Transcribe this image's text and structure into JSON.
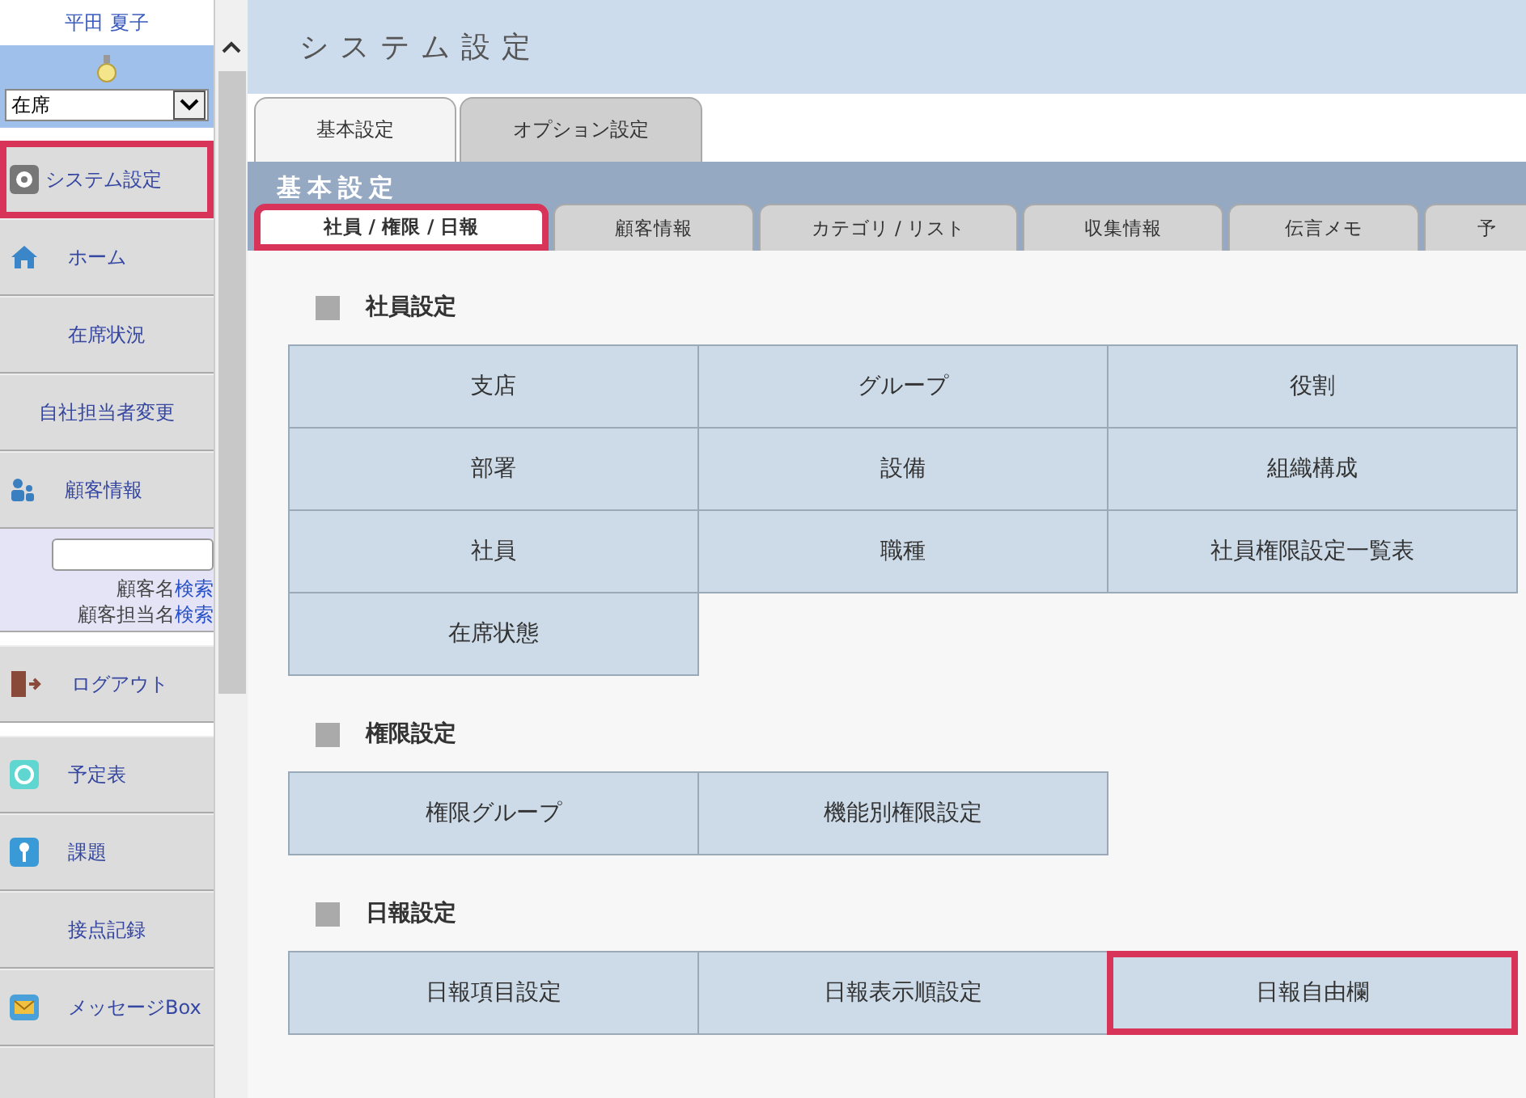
{
  "sidebar": {
    "user_name": "平田 夏子",
    "status_select": {
      "value": "在席"
    },
    "top_nav": [
      {
        "label": "システム設定",
        "highlighted": true
      },
      {
        "label": "ホーム",
        "highlighted": false
      },
      {
        "label": "在席状況",
        "highlighted": false
      },
      {
        "label": "自社担当者変更",
        "highlighted": false
      },
      {
        "label": "顧客情報",
        "highlighted": false
      }
    ],
    "customer_search": {
      "links": [
        {
          "label": "顧客名",
          "link": "検索"
        },
        {
          "label": "顧客担当名",
          "link": "検索"
        }
      ]
    },
    "logout": {
      "label": "ログアウト"
    },
    "bottom_nav": [
      {
        "label": "予定表"
      },
      {
        "label": "課題"
      },
      {
        "label": "接点記録"
      },
      {
        "label": "メッセージBox"
      }
    ]
  },
  "page": {
    "title": "システム設定",
    "tabs": [
      {
        "label": "基本設定",
        "selected": true
      },
      {
        "label": "オプション設定",
        "selected": false
      }
    ],
    "band_title": "基本設定",
    "subtabs": [
      {
        "label": "社員 / 権限 / 日報",
        "selected": true,
        "highlighted": true
      },
      {
        "label": "顧客情報",
        "selected": false,
        "highlighted": false
      },
      {
        "label": "カテゴリ / リスト",
        "selected": false,
        "highlighted": false
      },
      {
        "label": "収集情報",
        "selected": false,
        "highlighted": false
      },
      {
        "label": "伝言メモ",
        "selected": false,
        "highlighted": false
      },
      {
        "label": "予",
        "selected": false,
        "highlighted": false
      }
    ],
    "sections": [
      {
        "title": "社員設定",
        "buttons": [
          {
            "label": "支店",
            "highlighted": false
          },
          {
            "label": "グループ",
            "highlighted": false
          },
          {
            "label": "役割",
            "highlighted": false
          },
          {
            "label": "部署",
            "highlighted": false
          },
          {
            "label": "設備",
            "highlighted": false
          },
          {
            "label": "組織構成",
            "highlighted": false
          },
          {
            "label": "社員",
            "highlighted": false
          },
          {
            "label": "職種",
            "highlighted": false
          },
          {
            "label": "社員権限設定一覧表",
            "highlighted": false
          },
          {
            "label": "在席状態",
            "highlighted": false
          }
        ]
      },
      {
        "title": "権限設定",
        "buttons": [
          {
            "label": "権限グループ",
            "highlighted": false
          },
          {
            "label": "機能別権限設定",
            "highlighted": false
          }
        ]
      },
      {
        "title": "日報設定",
        "buttons": [
          {
            "label": "日報項目設定",
            "highlighted": false
          },
          {
            "label": "日報表示順設定",
            "highlighted": false
          },
          {
            "label": "日報自由欄",
            "highlighted": true
          }
        ]
      }
    ]
  }
}
